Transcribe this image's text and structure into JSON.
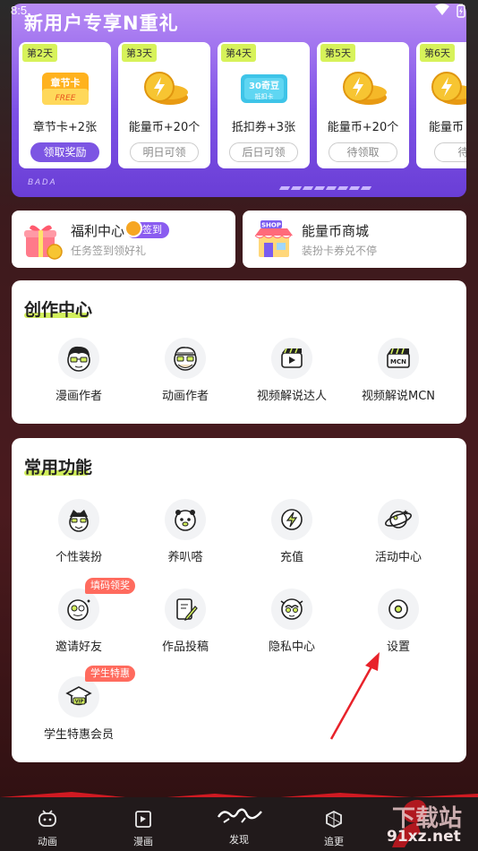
{
  "status_bar": {
    "time": "8:5"
  },
  "promo": {
    "title": "新用户专享N重礼",
    "footer": "BADA",
    "cards": [
      {
        "day": "第2天",
        "reward": "章节卡+2张",
        "icon": "chapter-card-icon",
        "icon_text": "章节卡",
        "icon_sub": "FREE",
        "button": "领取奖励",
        "active": true
      },
      {
        "day": "第3天",
        "reward": "能量币+20个",
        "icon": "energy-coin-icon",
        "button": "明日可领",
        "active": false
      },
      {
        "day": "第4天",
        "reward": "抵扣券+3张",
        "icon": "coupon-icon",
        "icon_text": "30奇豆",
        "icon_sub": "抵扣卡",
        "button": "后日可领",
        "active": false
      },
      {
        "day": "第5天",
        "reward": "能量币+20个",
        "icon": "energy-coin-icon",
        "button": "待领取",
        "active": false
      },
      {
        "day": "第6天",
        "reward": "能量币",
        "icon": "energy-coin-icon",
        "button": "待领",
        "active": false
      }
    ]
  },
  "quick_cards": {
    "welfare": {
      "title": "福利中心",
      "badge": "签到",
      "subtitle": "任务签到领好礼",
      "icon": "gift-icon"
    },
    "shop": {
      "title": "能量币商城",
      "subtitle": "装扮卡券兑不停",
      "icon": "shop-icon",
      "icon_text": "SHOP"
    }
  },
  "creator_center": {
    "title": "创作中心",
    "items": [
      {
        "label": "漫画作者",
        "icon": "comic-author-icon"
      },
      {
        "label": "动画作者",
        "icon": "animation-author-icon"
      },
      {
        "label": "视频解说达人",
        "icon": "video-commentator-icon"
      },
      {
        "label": "视频解说MCN",
        "icon": "mcn-icon",
        "icon_text": "MCN"
      }
    ]
  },
  "common_functions": {
    "title": "常用功能",
    "items": [
      {
        "label": "个性装扮",
        "icon": "dress-up-icon"
      },
      {
        "label": "养叭嗒",
        "icon": "pet-icon"
      },
      {
        "label": "充值",
        "icon": "recharge-icon"
      },
      {
        "label": "活动中心",
        "icon": "activity-center-icon"
      },
      {
        "label": "邀请好友",
        "icon": "invite-friends-icon",
        "tag": "填码领奖"
      },
      {
        "label": "作品投稿",
        "icon": "submit-work-icon"
      },
      {
        "label": "隐私中心",
        "icon": "privacy-center-icon"
      },
      {
        "label": "设置",
        "icon": "settings-icon"
      },
      {
        "label": "学生特惠会员",
        "icon": "student-vip-icon",
        "tag": "学生特惠",
        "icon_text": "VIP"
      }
    ]
  },
  "bottom_nav": {
    "items": [
      {
        "label": "动画",
        "icon": "animation-tab-icon"
      },
      {
        "label": "漫画",
        "icon": "comic-tab-icon"
      },
      {
        "label": "发现",
        "icon": "discover-tab-icon"
      },
      {
        "label": "追更",
        "icon": "follow-tab-icon"
      }
    ]
  },
  "watermark": {
    "line1": "下载站",
    "line2": "91xz.net"
  },
  "colors": {
    "accent_purple": "#7c55e3",
    "accent_lime": "#d2ef5c",
    "tag_red": "#ff6b5e",
    "arrow_red": "#e8222a"
  }
}
